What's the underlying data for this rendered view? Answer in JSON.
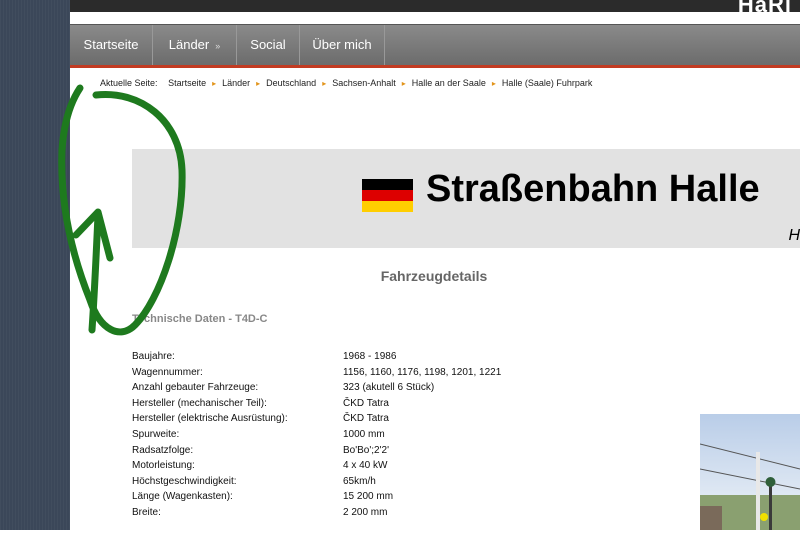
{
  "header": {
    "logo_fragment": "HaRi"
  },
  "nav": {
    "items": [
      {
        "label": "Startseite"
      },
      {
        "label": "Länder",
        "chevron": "»"
      },
      {
        "label": "Social"
      },
      {
        "label": "Über mich"
      }
    ]
  },
  "breadcrumb": {
    "prefix": "Aktuelle Seite:",
    "items": [
      "Startseite",
      "Länder",
      "Deutschland",
      "Sachsen-Anhalt",
      "Halle an der Saale",
      "Halle (Saale) Fuhrpark"
    ],
    "separator": "▸"
  },
  "headline": {
    "title": "Straßenbahn Halle",
    "subtitle": "H",
    "flag_colors": [
      "#000000",
      "#dd0000",
      "#ffce00"
    ]
  },
  "details": {
    "section_title": "Fahrzeugdetails",
    "subhead": "Technische Daten - T4D-C",
    "rows": [
      {
        "label": "Baujahre:",
        "value": "1968 - 1986"
      },
      {
        "label": "Wagennummer:",
        "value": "1156, 1160, 1176, 1198, 1201, 1221"
      },
      {
        "label": "Anzahl gebauter Fahrzeuge:",
        "value": "323 (akutell 6 Stück)"
      },
      {
        "label": "Hersteller (mechanischer Teil):",
        "value": "ČKD Tatra"
      },
      {
        "label": "Hersteller (elektrische Ausrüstung):",
        "value": "ČKD Tatra"
      },
      {
        "label": "Spurweite:",
        "value": "1000 mm"
      },
      {
        "label": "Radsatzfolge:",
        "value": "Bo'Bo';2'2'"
      },
      {
        "label": "Motorleistung:",
        "value": "4 x 40 kW"
      },
      {
        "label": "Höchstgeschwindigkeit:",
        "value": "65km/h"
      },
      {
        "label": "Länge (Wagenkasten):",
        "value": "15 200 mm"
      },
      {
        "label": "Breite:",
        "value": "2 200 mm"
      }
    ]
  },
  "colors": {
    "accent_rule": "#c23b22",
    "breadcrumb_separator": "#e2941b",
    "scribble": "#1e7a1e"
  }
}
